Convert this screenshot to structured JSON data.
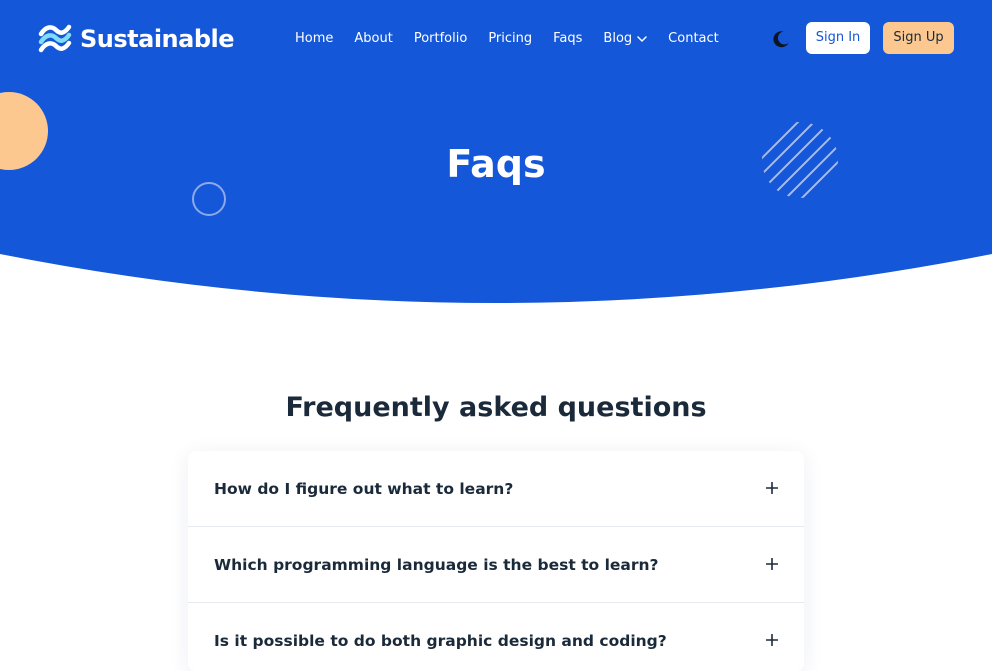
{
  "brand": {
    "name": "Sustainable",
    "primary_color": "#1457d8",
    "accent_color": "#fcc890",
    "logo_icon": "wave-logo-icon"
  },
  "nav": {
    "items": [
      {
        "label": "Home"
      },
      {
        "label": "About"
      },
      {
        "label": "Portfolio"
      },
      {
        "label": "Pricing"
      },
      {
        "label": "Faqs"
      },
      {
        "label": "Blog",
        "icon": "chevron-down-icon"
      },
      {
        "label": "Contact"
      }
    ],
    "theme_toggle_icon": "moon-icon",
    "signin_label": "Sign In",
    "signup_label": "Sign Up"
  },
  "hero": {
    "title": "Faqs"
  },
  "faq": {
    "heading": "Frequently asked questions",
    "toggle_icon": "plus-icon",
    "items": [
      {
        "question": "How do I figure out what to learn?"
      },
      {
        "question": "Which programming language is the best to learn?"
      },
      {
        "question": "Is it possible to do both graphic design and coding?"
      }
    ]
  }
}
